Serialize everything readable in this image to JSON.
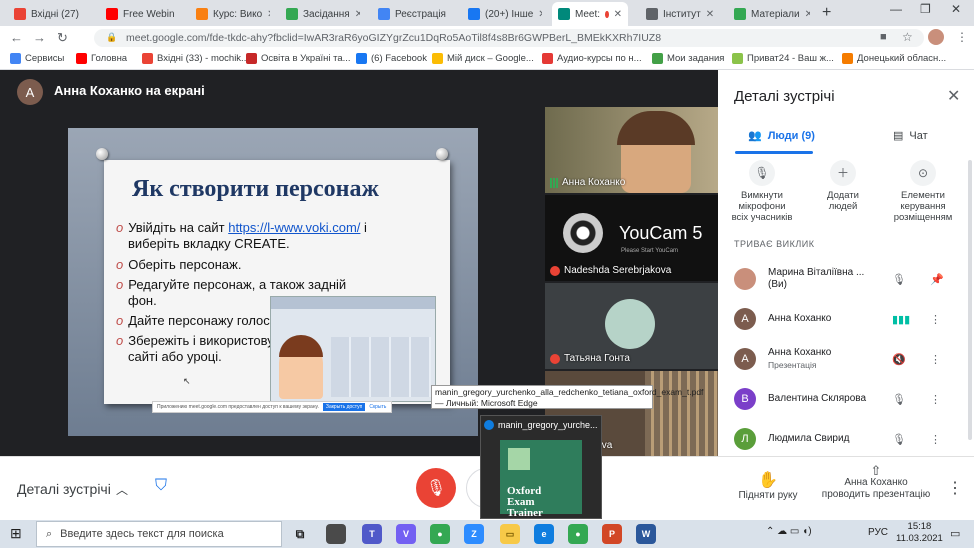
{
  "browser": {
    "tabs": [
      {
        "label": "Вхідні (27)",
        "icon": "gmail-icon",
        "color": "#ea4335"
      },
      {
        "label": "Free Webin",
        "icon": "youtube-icon",
        "color": "#ff0000"
      },
      {
        "label": "Курс: Вико",
        "icon": "moodle-icon",
        "color": "#f98012"
      },
      {
        "label": "Засідання",
        "icon": "drive-icon",
        "color": "#34a853"
      },
      {
        "label": "Реєстрація",
        "icon": "forms-icon",
        "color": "#4285f4"
      },
      {
        "label": "(20+) Інше",
        "icon": "facebook-icon",
        "color": "#1877f2"
      },
      {
        "label": "Meet:",
        "icon": "meet-icon",
        "color": "#00897b"
      },
      {
        "label": "Інститут",
        "icon": "site-icon",
        "color": "#5f6368"
      },
      {
        "label": "Матеріали",
        "icon": "site-icon",
        "color": "#34a853"
      }
    ],
    "url": "meet.google.com/fde-tkdc-ahy?fbclid=IwAR3raR6yoGIZYgrZcu1DqRo5AoTil8f4s8Br6GWPBerL_BMEkKXRh7IUZ8",
    "bookmarks": [
      {
        "label": "Сервисы",
        "color": "#4285f4"
      },
      {
        "label": "Головна",
        "color": "#ff0000"
      },
      {
        "label": "Вхідні (33) - mochik...",
        "color": "#ea4335"
      },
      {
        "label": "Освіта в Україні та...",
        "color": "#c62828"
      },
      {
        "label": "(6) Facebook",
        "color": "#1877f2"
      },
      {
        "label": "Мій диск – Google...",
        "color": "#fbbc04"
      },
      {
        "label": "Аудио-курсы по н...",
        "color": "#e53935"
      },
      {
        "label": "Мои задания",
        "color": "#43a047"
      },
      {
        "label": "Приват24 - Ваш ж...",
        "color": "#8bc34a"
      },
      {
        "label": "Донецький обласн...",
        "color": "#f57c00"
      }
    ]
  },
  "meet": {
    "presenter_initial": "А",
    "presenter_title": "Анна Коханко на екрані",
    "slide": {
      "title": "Як створити персонаж",
      "bullet1_a": "Увійдіть на сайт ",
      "bullet1_link": "https://l-www.voki.com/",
      "bullet1_b": " і",
      "bullet1_c": "виберіть вкладку CREATE.",
      "bullet2": "Оберіть персонаж.",
      "bullet3_a": "Редагуйте персонаж, а також задній",
      "bullet3_b": "фон.",
      "bullet4": "Дайте персонажу голос.",
      "bullet5_a": "Збережіть і використовуйте на своєму",
      "bullet5_b": "сайті або уроці.",
      "share_notice": "Приложению meet.google.com предоставлен доступ к вашему экрану.",
      "share_stop": "Закрыть доступ",
      "share_hide": "Скрыть"
    },
    "tiles": [
      {
        "name": "Анна Коханко",
        "mic": "on"
      },
      {
        "name": "Nadeshda Serebrjakova",
        "mic": "off",
        "youcam": "YouCam 5",
        "youcam_sub": "Please Start YouCam"
      },
      {
        "name": "Татьяна Гонта",
        "mic": "off"
      },
      {
        "name": "ia Lugantsova",
        "mic": "none"
      }
    ],
    "tooltip": "manin_gregory_yurchenko_alla_redchenko_tetiana_oxford_exam_t.pdf — Личный: Microsoft Edge",
    "thumb_title": "manin_gregory_yurche...",
    "thumb_book": "Oxford Exam Trainer",
    "bottom": {
      "details_label": "Деталі зустрічі",
      "raise_hand": "Підняти руку",
      "presenting": "Анна Коханко проводить презентацію"
    },
    "panel": {
      "title": "Деталі зустрічі",
      "tab_people": "Люди (9)",
      "tab_chat": "Чат",
      "actions": [
        "Вимкнути мікрофони всіх учасників",
        "Додати людей",
        "Елементи керування розміщенням"
      ],
      "section": "ТРИВАЄ ВИКЛИК",
      "people": [
        {
          "name": "Марина Віталіївна ... (Ви)",
          "initial": "",
          "color": "#c98f7b",
          "sub": ""
        },
        {
          "name": "Анна Коханко",
          "initial": "А",
          "color": "#7c5c4e",
          "sub": ""
        },
        {
          "name": "Анна Коханко",
          "initial": "А",
          "color": "#7c5c4e",
          "sub": "Презентація"
        },
        {
          "name": "Валентина Склярова",
          "initial": "В",
          "color": "#7b3fc9",
          "sub": ""
        },
        {
          "name": "Людмила Свирид",
          "initial": "Л",
          "color": "#5a9e3a",
          "sub": ""
        }
      ]
    }
  },
  "taskbar": {
    "search_placeholder": "Введите здесь текст для поиска",
    "lang": "РУС",
    "time": "15:18",
    "date": "11.03.2021"
  }
}
